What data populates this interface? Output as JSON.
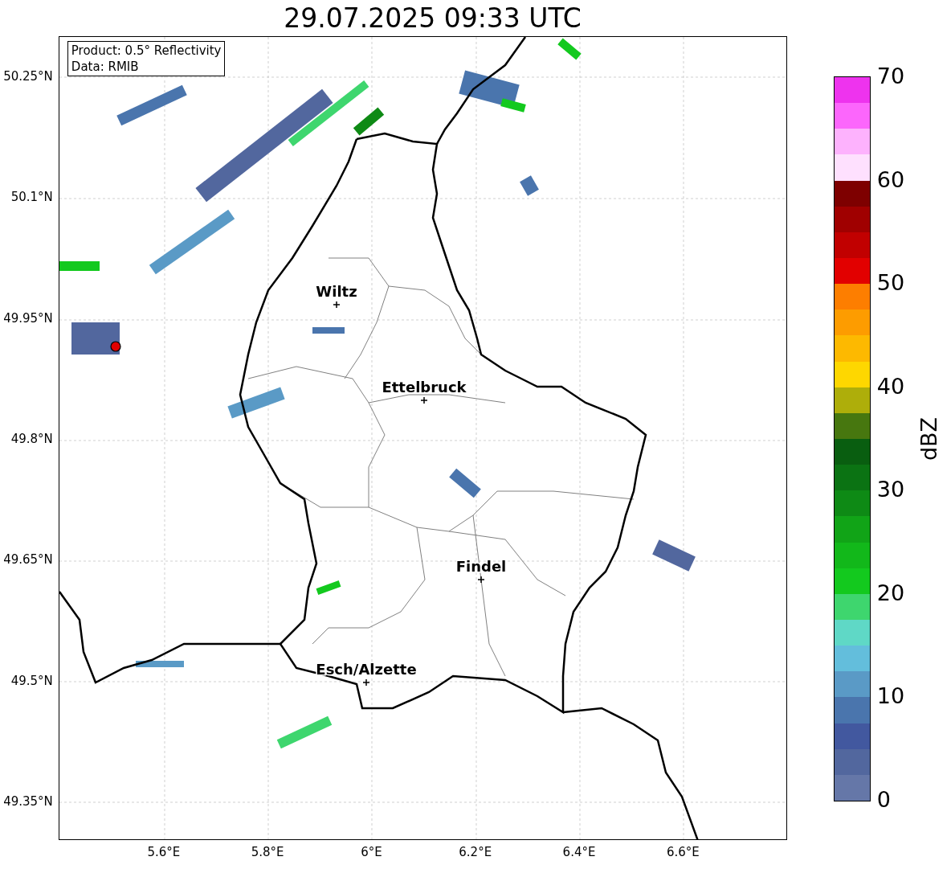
{
  "title": "29.07.2025 09:33 UTC",
  "info_box": {
    "lines": [
      "Product: 0.5° Reflectivity",
      "Data: RMIB"
    ]
  },
  "map": {
    "y_ticks": [
      "50.25°N",
      "50.1°N",
      "49.95°N",
      "49.8°N",
      "49.65°N",
      "49.5°N",
      "49.35°N"
    ],
    "x_ticks": [
      "5.6°E",
      "5.8°E",
      "6°E",
      "6.2°E",
      "6.4°E",
      "6.6°E"
    ],
    "cities": [
      {
        "name": "Wiltz"
      },
      {
        "name": "Ettelbruck"
      },
      {
        "name": "Findel"
      },
      {
        "name": "Esch/Alzette"
      }
    ]
  },
  "colorbar": {
    "label": "dBZ",
    "ticks": [
      "70",
      "60",
      "50",
      "40",
      "30",
      "20",
      "10",
      "0"
    ],
    "bins": [
      {
        "color": "#6577a8"
      },
      {
        "color": "#52679e"
      },
      {
        "color": "#42589f"
      },
      {
        "color": "#4a75ad"
      },
      {
        "color": "#5a9ac6"
      },
      {
        "color": "#63bedc"
      },
      {
        "color": "#5fd8c6"
      },
      {
        "color": "#3ed66e"
      },
      {
        "color": "#13c91e"
      },
      {
        "color": "#12b81a"
      },
      {
        "color": "#11a417"
      },
      {
        "color": "#0e8a15"
      },
      {
        "color": "#0b7313"
      },
      {
        "color": "#095e10"
      },
      {
        "color": "#47770f"
      },
      {
        "color": "#aeae0a"
      },
      {
        "color": "#fed700"
      },
      {
        "color": "#fdb900"
      },
      {
        "color": "#fd9c00"
      },
      {
        "color": "#fd7e00"
      },
      {
        "color": "#e20000"
      },
      {
        "color": "#c10000"
      },
      {
        "color": "#a00000"
      },
      {
        "color": "#7e0000"
      },
      {
        "color": "#fee0fe"
      },
      {
        "color": "#fdb2fd"
      },
      {
        "color": "#fc66fc"
      },
      {
        "color": "#ee33ee"
      }
    ]
  }
}
